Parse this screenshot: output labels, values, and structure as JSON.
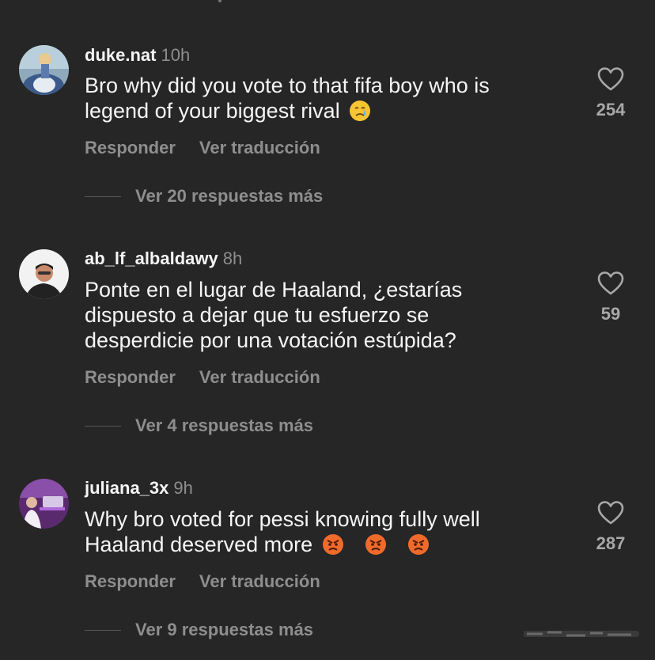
{
  "comments": [
    {
      "username": "duke.nat",
      "time": "10h",
      "text_lines": [
        "Bro why did you vote to that fifa boy  who is",
        "legend of your biggest rival "
      ],
      "emoji": [
        "crying-face"
      ],
      "likes": "254",
      "reply_label": "Responder",
      "translate_label": "Ver traducción",
      "view_replies": "Ver 20 respuestas más",
      "avatar_colors": {
        "bg": "#8faabd",
        "figure": "#e6ecf2",
        "accent": "#3b5a8a"
      }
    },
    {
      "username": "ab_lf_albaldawy",
      "time": "8h",
      "text_lines": [
        "Ponte en el lugar de Haaland, ¿estarías",
        "dispuesto a dejar que tu esfuerzo se",
        "desperdicie por una votación estúpida?"
      ],
      "emoji": [],
      "likes": "59",
      "reply_label": "Responder",
      "translate_label": "Ver traducción",
      "view_replies": "Ver 4 respuestas más",
      "avatar_colors": {
        "bg": "#f2f2f2",
        "figure": "#c98a6b",
        "accent": "#222222"
      }
    },
    {
      "username": "juliana_3x",
      "time": "9h",
      "text_lines": [
        "Why bro voted for pessi knowing fully well",
        "Haaland deserved more "
      ],
      "emoji": [
        "angry-face",
        "angry-face",
        "angry-face"
      ],
      "likes": "287",
      "reply_label": "Responder",
      "translate_label": "Ver traducción",
      "view_replies": "Ver 9 respuestas más",
      "avatar_colors": {
        "bg": "#5a2a6e",
        "figure": "#d7c8e8",
        "accent": "#b06ad8"
      }
    }
  ],
  "colors": {
    "background": "#262626",
    "primary_text": "#f5f5f5",
    "secondary_text": "#8e8e8e",
    "like_count": "#a8a8a8"
  },
  "icons": {
    "like": "heart-outline-icon",
    "crying": "crying-face-emoji",
    "angry": "angry-face-emoji"
  }
}
